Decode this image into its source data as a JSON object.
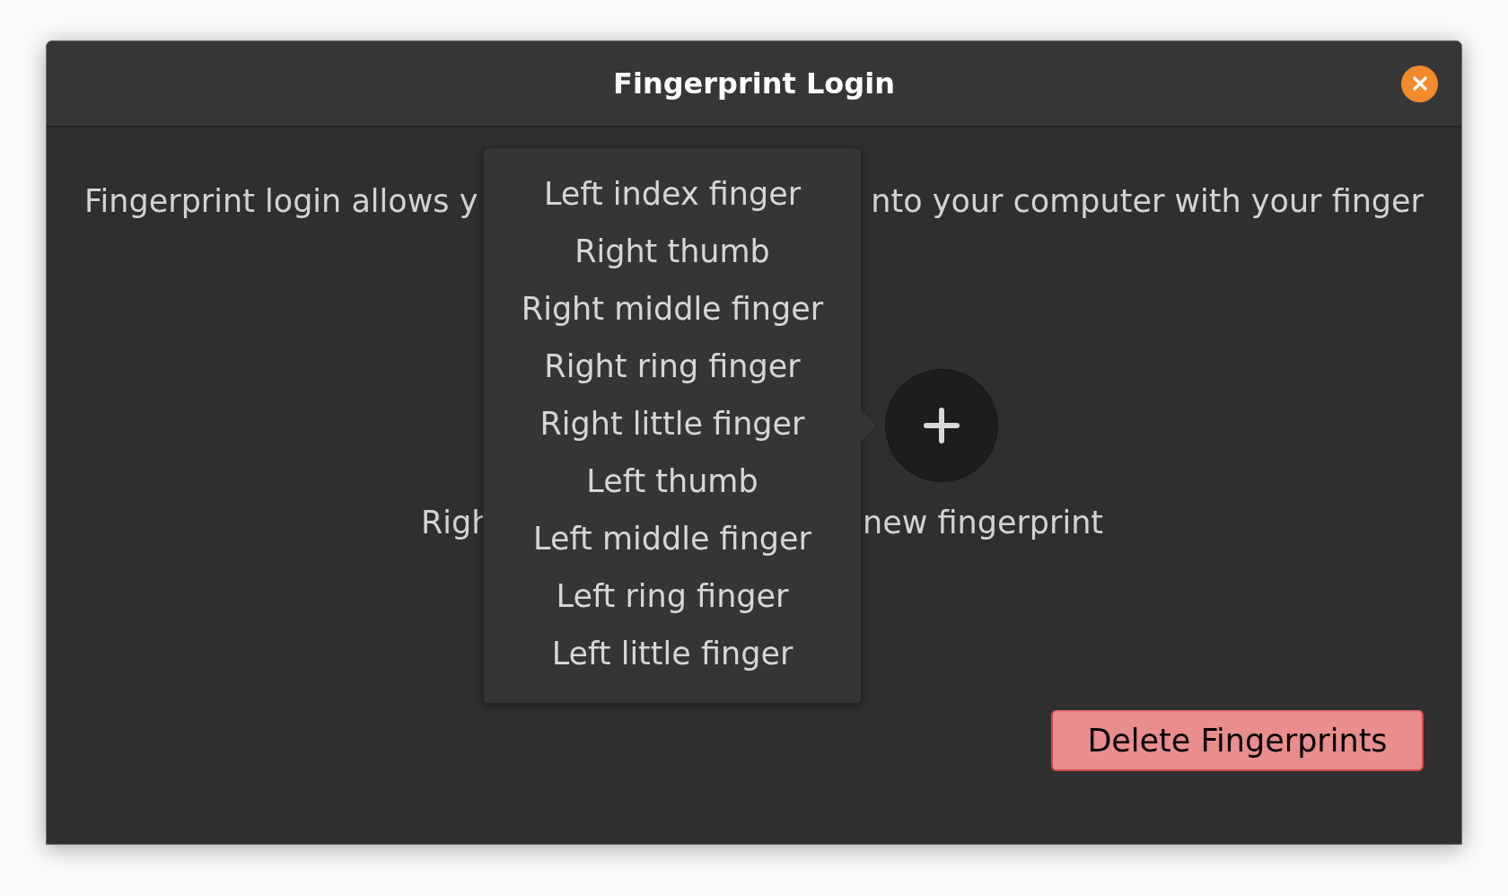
{
  "window": {
    "title": "Fingerprint Login"
  },
  "description": [
    "Fingerprint login allows y",
    "nto your computer with your finger"
  ],
  "finger_menu": {
    "items": [
      "Left index finger",
      "Right thumb",
      "Right middle finger",
      "Right ring finger",
      "Right little finger",
      "Left thumb",
      "Left middle finger",
      "Left ring finger",
      "Left little finger"
    ]
  },
  "captions": [
    "Righ",
    "new fingerprint"
  ],
  "buttons": [
    "Delete Fingerprints"
  ]
}
